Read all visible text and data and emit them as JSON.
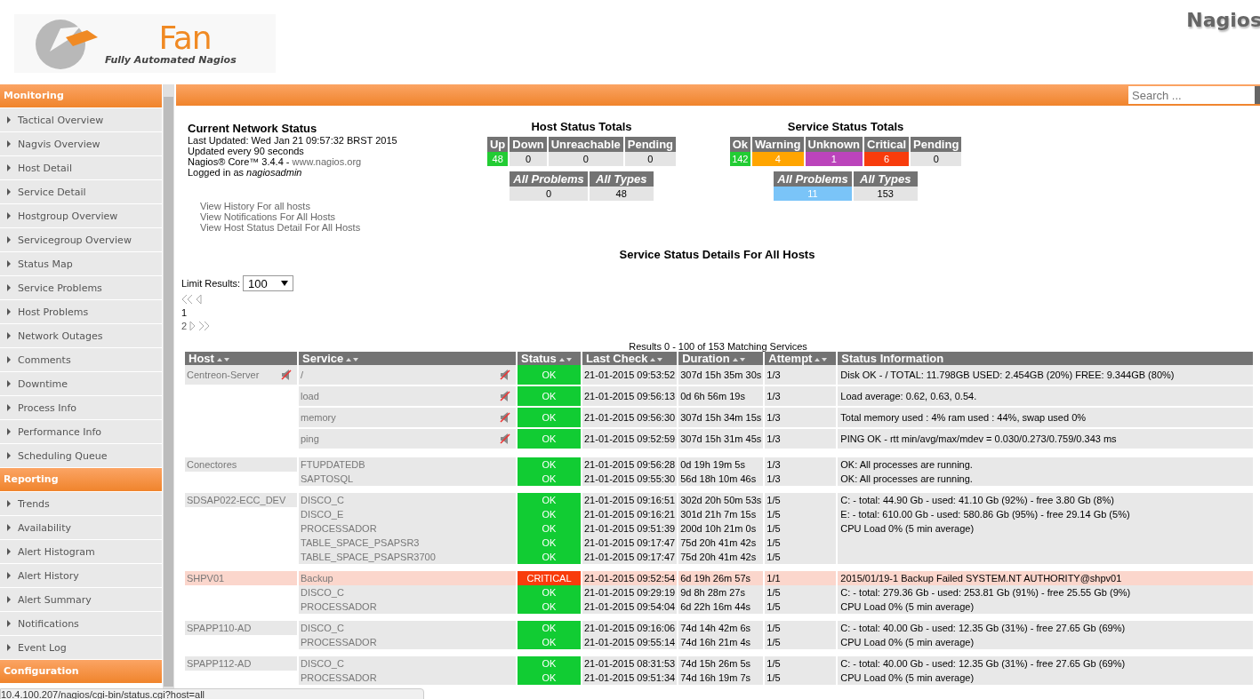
{
  "logo": {
    "title": "Fan",
    "subtitle": "Fully Automated Nagios"
  },
  "brand": "Nagios",
  "search": {
    "placeholder": "Search ..."
  },
  "sidebar": [
    {
      "title": "Monitoring",
      "items": [
        "Tactical Overview",
        "Nagvis Overview",
        "Host Detail",
        "Service Detail",
        "Hostgroup Overview",
        "Servicegroup Overview",
        "Status Map",
        "Service Problems",
        "Host Problems",
        "Network Outages",
        "Comments",
        "Downtime",
        "Process Info",
        "Performance Info",
        "Scheduling Queue"
      ]
    },
    {
      "title": "Reporting",
      "items": [
        "Trends",
        "Availability",
        "Alert Histogram",
        "Alert History",
        "Alert Summary",
        "Notifications",
        "Event Log"
      ]
    },
    {
      "title": "Configuration"
    }
  ],
  "network_status": {
    "title": "Current Network Status",
    "last_updated": "Last Updated: Wed Jan 21 09:57:32 BRST 2015",
    "interval": "Updated every 90 seconds",
    "version": "Nagios® Core™ 3.4.4 - ",
    "version_link": "www.nagios.org",
    "logged_in": "Logged in as ",
    "user": "nagiosadmin",
    "links": [
      "View History For all hosts",
      "View Notifications For All Hosts",
      "View Host Status Detail For All Hosts"
    ]
  },
  "host_totals": {
    "title": "Host Status Totals",
    "items": [
      {
        "label": "Up",
        "count": "48",
        "color": "#22cc33"
      },
      {
        "label": "Down",
        "count": "0",
        "color": "#e4e4e4"
      },
      {
        "label": "Unreachable",
        "count": "0",
        "color": "#e4e4e4"
      },
      {
        "label": "Pending",
        "count": "0",
        "color": "#e4e4e4"
      }
    ],
    "summary": [
      {
        "label": "All Problems",
        "count": "0",
        "color": "#e4e4e4"
      },
      {
        "label": "All Types",
        "count": "48",
        "color": "#e4e4e4"
      }
    ]
  },
  "service_totals": {
    "title": "Service Status Totals",
    "items": [
      {
        "label": "Ok",
        "count": "142",
        "color": "#22cc33"
      },
      {
        "label": "Warning",
        "count": "4",
        "color": "#ffa500"
      },
      {
        "label": "Unknown",
        "count": "1",
        "color": "#bb44bb"
      },
      {
        "label": "Critical",
        "count": "6",
        "color": "#f83c0c"
      },
      {
        "label": "Pending",
        "count": "0",
        "color": "#e4e4e4"
      }
    ],
    "summary": [
      {
        "label": "All Problems",
        "count": "11",
        "color": "#7ac4f8"
      },
      {
        "label": "All Types",
        "count": "153",
        "color": "#e4e4e4"
      }
    ]
  },
  "details_title": "Service Status Details For All Hosts",
  "limit": {
    "label": "Limit Results:",
    "value": "100"
  },
  "pages": [
    "1",
    "2"
  ],
  "results": "Results 0 - 100 of 153 Matching Services",
  "table": {
    "columns": [
      "Host",
      "Service",
      "Status",
      "Last Check",
      "Duration",
      "Attempt",
      "Status Information"
    ],
    "hosts": [
      {
        "name": "Centreon-Server",
        "notifications_disabled": true,
        "services": [
          {
            "service": "/",
            "notifications_disabled": true,
            "kind": "ok",
            "status": "OK",
            "last_check": "21-01-2015 09:53:52",
            "duration": "307d 15h 35m 30s",
            "attempt": "1/3",
            "info": "Disk OK - / TOTAL: 11.798GB USED: 2.454GB (20%) FREE: 9.344GB (80%)"
          },
          {
            "service": "load",
            "notifications_disabled": true,
            "kind": "ok",
            "status": "OK",
            "last_check": "21-01-2015 09:56:13",
            "duration": "0d 6h 56m 19s",
            "attempt": "1/3",
            "info": "Load average: 0.62, 0.63, 0.54."
          },
          {
            "service": "memory",
            "notifications_disabled": true,
            "kind": "ok",
            "status": "OK",
            "last_check": "21-01-2015 09:56:30",
            "duration": "307d 15h 34m 15s",
            "attempt": "1/3",
            "info": "Total memory used : 4% ram used : 44%, swap used 0%"
          },
          {
            "service": "ping",
            "notifications_disabled": true,
            "kind": "ok",
            "status": "OK",
            "last_check": "21-01-2015 09:52:59",
            "duration": "307d 15h 31m 45s",
            "attempt": "1/3",
            "info": "PING OK - rtt min/avg/max/mdev = 0.030/0.273/0.759/0.343 ms"
          }
        ]
      },
      {
        "name": "Conectores",
        "notifications_disabled": false,
        "services": [
          {
            "service": "FTUPDATEDB",
            "notifications_disabled": false,
            "kind": "ok",
            "status": "OK",
            "last_check": "21-01-2015 09:56:28",
            "duration": "0d 19h 19m 5s",
            "attempt": "1/3",
            "info": "OK: All processes are running."
          },
          {
            "service": "SAPTOSQL",
            "notifications_disabled": false,
            "kind": "ok",
            "status": "OK",
            "last_check": "21-01-2015 09:55:30",
            "duration": "56d 18h 10m 46s",
            "attempt": "1/3",
            "info": "OK: All processes are running."
          }
        ]
      },
      {
        "name": "SDSAP022-ECC_DEV",
        "notifications_disabled": false,
        "services": [
          {
            "service": "DISCO_C",
            "notifications_disabled": false,
            "kind": "ok",
            "status": "OK",
            "last_check": "21-01-2015 09:16:51",
            "duration": "302d 20h 50m 53s",
            "attempt": "1/5",
            "info": "C: - total: 44.90 Gb - used: 41.10 Gb (92%) - free 3.80 Gb (8%)"
          },
          {
            "service": "DISCO_E",
            "notifications_disabled": false,
            "kind": "ok",
            "status": "OK",
            "last_check": "21-01-2015 09:16:21",
            "duration": "301d 21h 7m 15s",
            "attempt": "1/5",
            "info": "E: - total: 610.00 Gb - used: 580.86 Gb (95%) - free 29.14 Gb (5%)"
          },
          {
            "service": "PROCESSADOR",
            "notifications_disabled": false,
            "kind": "ok",
            "status": "OK",
            "last_check": "21-01-2015 09:51:39",
            "duration": "200d 10h 21m 0s",
            "attempt": "1/5",
            "info": "CPU Load 0% (5 min average)"
          },
          {
            "service": "TABLE_SPACE_PSAPSR3",
            "notifications_disabled": false,
            "kind": "ok",
            "status": "OK",
            "last_check": "21-01-2015 09:17:47",
            "duration": "75d 20h 41m 42s",
            "attempt": "1/5"
          },
          {
            "service": "TABLE_SPACE_PSAPSR3700",
            "notifications_disabled": false,
            "kind": "ok",
            "status": "OK",
            "last_check": "21-01-2015 09:17:47",
            "duration": "75d 20h 41m 42s",
            "attempt": "1/5"
          }
        ]
      },
      {
        "name": "SHPV01",
        "notifications_disabled": false,
        "services": [
          {
            "service": "Backup",
            "notifications_disabled": false,
            "kind": "critical",
            "status": "CRITICAL",
            "last_check": "21-01-2015 09:52:54",
            "duration": "6d 19h 26m 57s",
            "attempt": "1/1",
            "info": "2015/01/19-1 Backup Failed SYSTEM.NT AUTHORITY@shpv01"
          },
          {
            "service": "DISCO_C",
            "notifications_disabled": false,
            "kind": "ok",
            "status": "OK",
            "last_check": "21-01-2015 09:29:19",
            "duration": "9d 8h 28m 27s",
            "attempt": "1/5",
            "info": "C: - total: 279.36 Gb - used: 253.81 Gb (91%) - free 25.55 Gb (9%)"
          },
          {
            "service": "PROCESSADOR",
            "notifications_disabled": false,
            "kind": "ok",
            "status": "OK",
            "last_check": "21-01-2015 09:54:04",
            "duration": "6d 22h 16m 44s",
            "attempt": "1/5",
            "info": "CPU Load 0% (5 min average)"
          }
        ]
      },
      {
        "name": "SPAPP110-AD",
        "notifications_disabled": false,
        "services": [
          {
            "service": "DISCO_C",
            "notifications_disabled": false,
            "kind": "ok",
            "status": "OK",
            "last_check": "21-01-2015 09:16:06",
            "duration": "74d 14h 42m 6s",
            "attempt": "1/5",
            "info": "C: - total: 40.00 Gb - used: 12.35 Gb (31%) - free 27.65 Gb (69%)"
          },
          {
            "service": "PROCESSADOR",
            "notifications_disabled": false,
            "kind": "ok",
            "status": "OK",
            "last_check": "21-01-2015 09:55:14",
            "duration": "74d 16h 21m 4s",
            "attempt": "1/5",
            "info": "CPU Load 0% (5 min average)"
          }
        ]
      },
      {
        "name": "SPAPP112-AD",
        "notifications_disabled": false,
        "services": [
          {
            "service": "DISCO_C",
            "notifications_disabled": false,
            "kind": "ok",
            "status": "OK",
            "last_check": "21-01-2015 08:31:53",
            "duration": "74d 15h 26m 5s",
            "attempt": "1/5",
            "info": "C: - total: 40.00 Gb - used: 12.35 Gb (31%) - free 27.65 Gb (69%)"
          },
          {
            "service": "PROCESSADOR",
            "notifications_disabled": false,
            "kind": "ok",
            "status": "OK",
            "last_check": "21-01-2015 09:51:34",
            "duration": "74d 16h 19m 7s",
            "attempt": "1/5",
            "info": "CPU Load 0% (5 min average)"
          }
        ]
      }
    ]
  },
  "status_bar": "10.4.100.207/nagios/cgi-bin/status.cgi?host=all"
}
